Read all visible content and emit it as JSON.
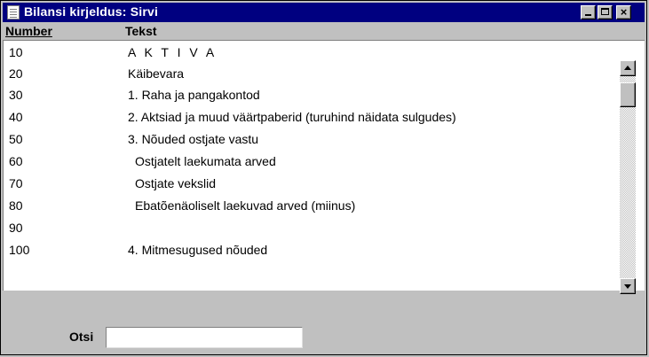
{
  "window": {
    "title": "Bilansi kirjeldus: Sirvi",
    "icons": {
      "app": "document-icon",
      "minimize": "minimize-icon",
      "maximize": "maximize-icon",
      "close": "close-icon"
    },
    "close_glyph": "×"
  },
  "columns": {
    "number": "Number",
    "text": "Tekst"
  },
  "rows": [
    {
      "number": "10",
      "text": "A K T I V A"
    },
    {
      "number": "20",
      "text": "Käibevara"
    },
    {
      "number": "30",
      "text": "1. Raha ja pangakontod"
    },
    {
      "number": "40",
      "text": "2. Aktsiad ja muud väärtpaberid (turuhind näidata sulgudes)"
    },
    {
      "number": "50",
      "text": "3. Nõuded ostjate vastu"
    },
    {
      "number": "60",
      "text": "Ostjatelt laekumata arved"
    },
    {
      "number": "70",
      "text": "Ostjate vekslid"
    },
    {
      "number": "80",
      "text": "Ebatõenäoliselt laekuvad arved (miinus)"
    },
    {
      "number": "90",
      "text": ""
    },
    {
      "number": "100",
      "text": "4. Mitmesugused nõuded"
    }
  ],
  "search": {
    "label": "Otsi",
    "value": ""
  },
  "colors": {
    "titlebar": "#000080",
    "face": "#c0c0c0"
  }
}
